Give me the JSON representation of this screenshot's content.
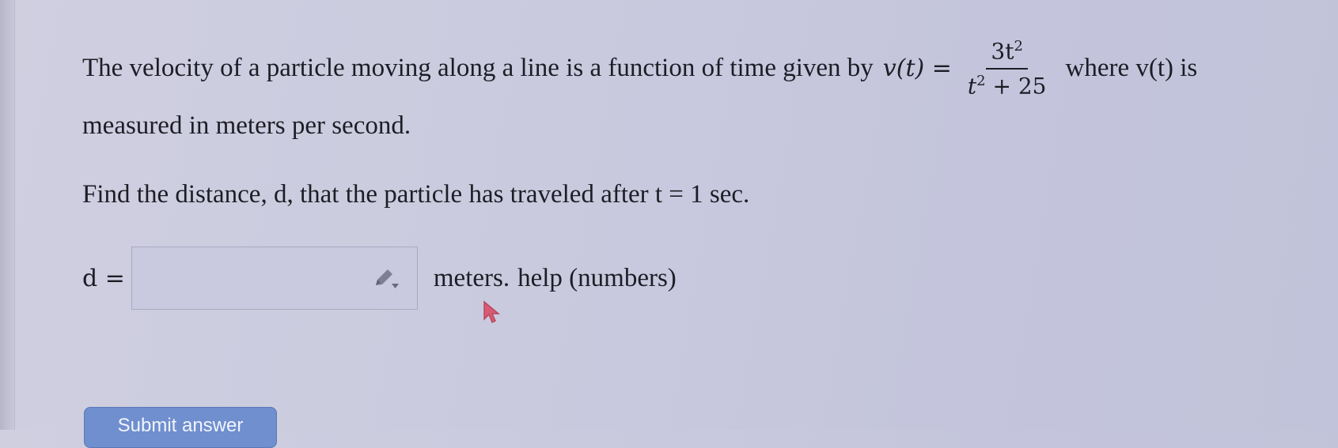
{
  "problem": {
    "text_before": "The velocity of a particle moving along a line is a function of time given by",
    "function_name": "v(t) =",
    "numerator": "3t",
    "numerator_exp": "2",
    "denominator_base": "t",
    "denominator_exp": "2",
    "denominator_rest": " + 25",
    "text_after": "where v(t) is",
    "line2": "measured in meters per second."
  },
  "question": {
    "text": "Find the distance, d, that the particle has traveled after t = 1 sec."
  },
  "answer": {
    "label": "d =",
    "value": "",
    "placeholder": "",
    "units": "meters.",
    "help_link": "help (numbers)"
  },
  "submit": {
    "label": "Submit answer"
  },
  "colors": {
    "background": "#cbcbdf",
    "text": "#1d1d26",
    "button": "#6f8fcf"
  },
  "icons": {
    "input_tool": "pencil-dropdown-icon",
    "mouse": "mouse-pointer-icon"
  }
}
